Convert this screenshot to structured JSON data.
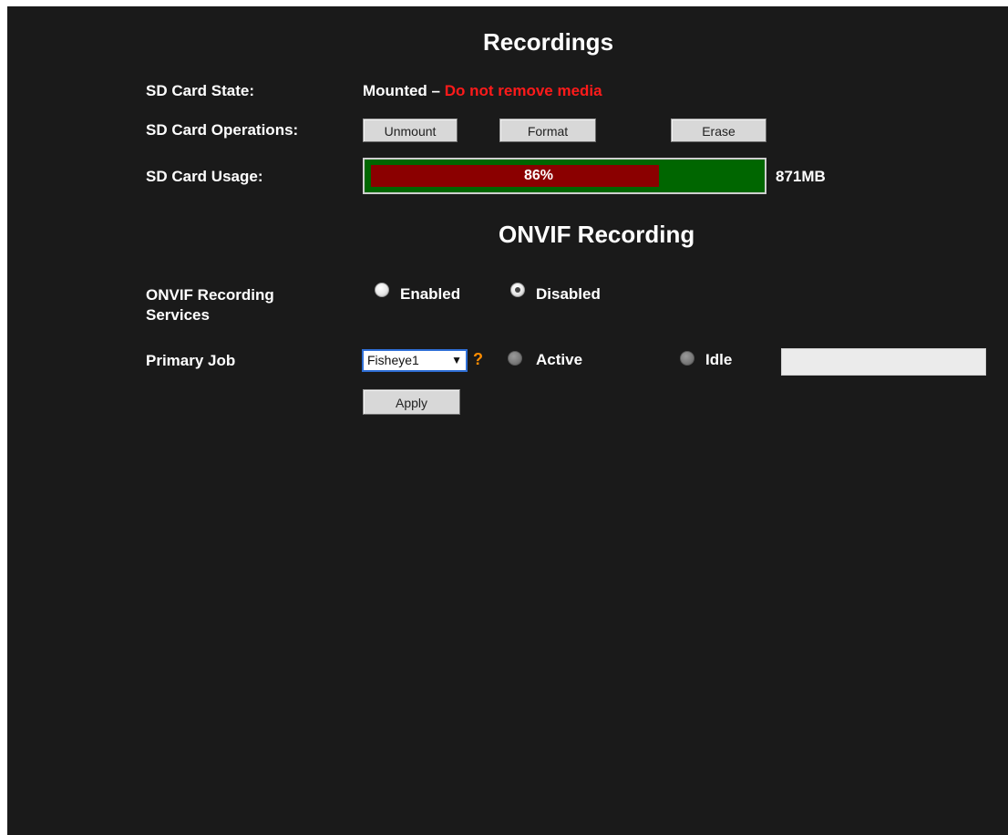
{
  "recordings": {
    "title": "Recordings",
    "sd_state_label": "SD Card State:",
    "sd_state_value": "Mounted – ",
    "sd_state_warning": "Do not remove media",
    "sd_operations_label": "SD Card Operations:",
    "unmount_label": "Unmount",
    "format_label": "Format",
    "erase_label": "Erase",
    "sd_usage_label": "SD Card Usage:",
    "usage_percent_text": "86%",
    "usage_fraction": 0.86,
    "capacity_text": "871MB"
  },
  "onvif": {
    "title": "ONVIF Recording",
    "services_label": "ONVIF Recording Services",
    "enabled_label": "Enabled",
    "disabled_label": "Disabled",
    "services_selected": "Disabled",
    "primary_job_label": "Primary Job",
    "job_selected": "Fisheye1",
    "help_glyph": "?",
    "active_label": "Active",
    "idle_label": "Idle",
    "status_value": "",
    "apply_label": "Apply"
  },
  "colors": {
    "background": "#1a1a1a",
    "warning": "#ff1a1a",
    "usage_used": "#8b0000",
    "usage_free": "#006600",
    "help": "#ff8c00"
  },
  "icons": {
    "help": "question-mark-icon",
    "dropdown": "chevron-down-icon"
  }
}
